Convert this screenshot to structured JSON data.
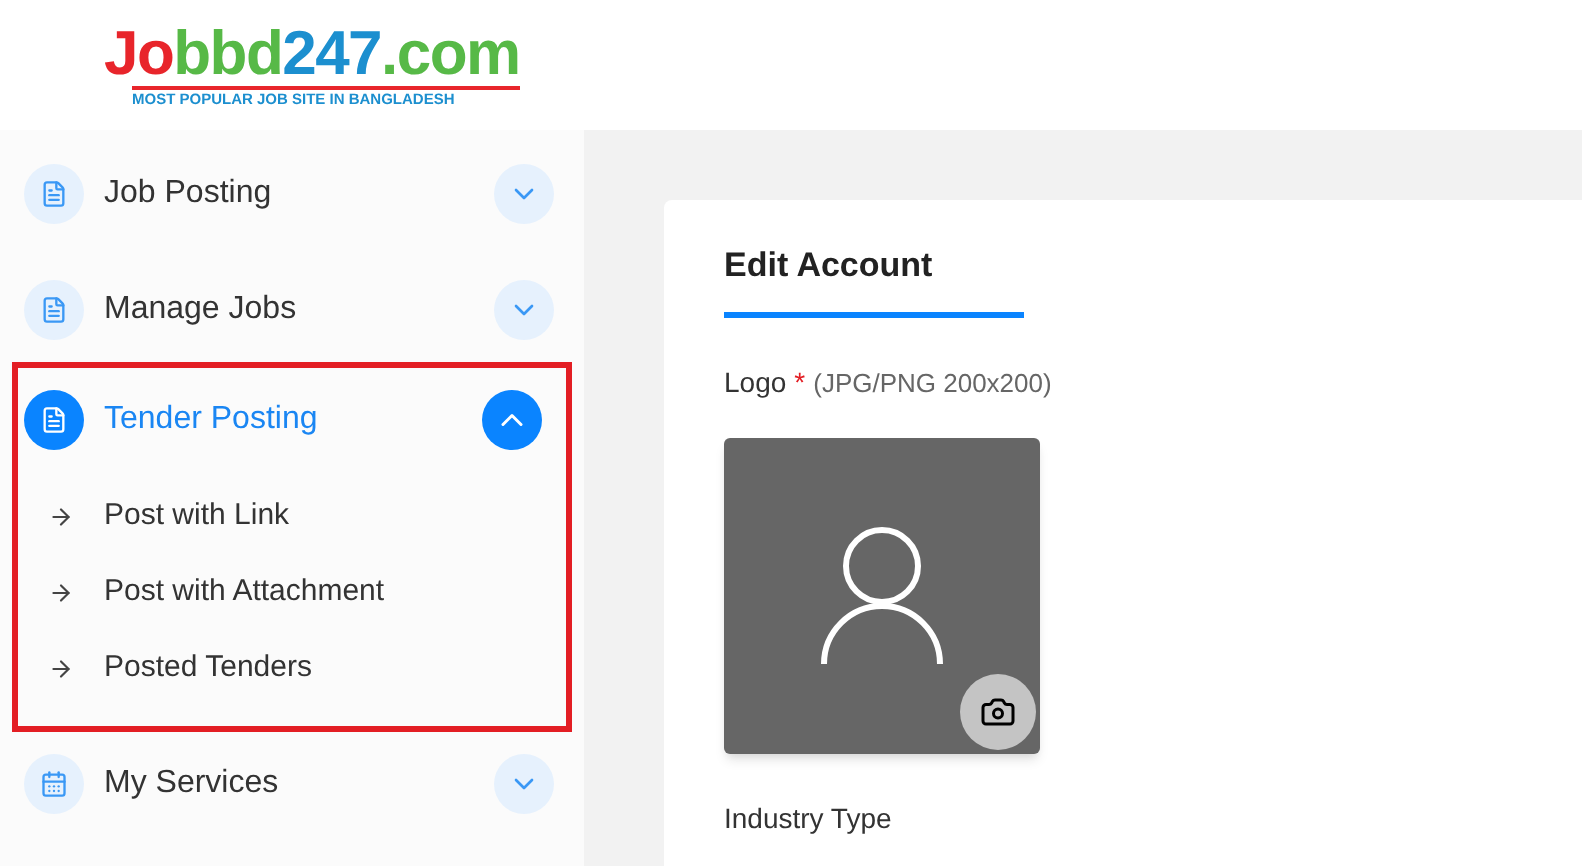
{
  "logo": {
    "parts": [
      {
        "text": "Jo",
        "color": "#e8252b"
      },
      {
        "text": "bbd",
        "color": "#57b947"
      },
      {
        "text": "247",
        "color": "#1c8fcf"
      },
      {
        "text": ".com",
        "color": "#57b947"
      }
    ],
    "tagline": "MOST POPULAR JOB SITE IN BANGLADESH"
  },
  "sidebar": {
    "items": [
      {
        "label": "Job Posting",
        "selected": false,
        "expanded": false,
        "highlighted": false
      },
      {
        "label": "Manage Jobs",
        "selected": false,
        "expanded": false,
        "highlighted": false
      },
      {
        "label": "Tender Posting",
        "selected": true,
        "expanded": true,
        "highlighted": true,
        "children": [
          {
            "label": "Post with Link"
          },
          {
            "label": "Post with Attachment"
          },
          {
            "label": "Posted Tenders"
          }
        ]
      },
      {
        "label": "My Services",
        "selected": false,
        "expanded": false,
        "highlighted": false
      }
    ]
  },
  "card": {
    "title": "Edit Account",
    "logo_field": {
      "label": "Logo",
      "required_mark": "*",
      "hint": "(JPG/PNG 200x200)"
    },
    "industry_label": "Industry Type"
  }
}
